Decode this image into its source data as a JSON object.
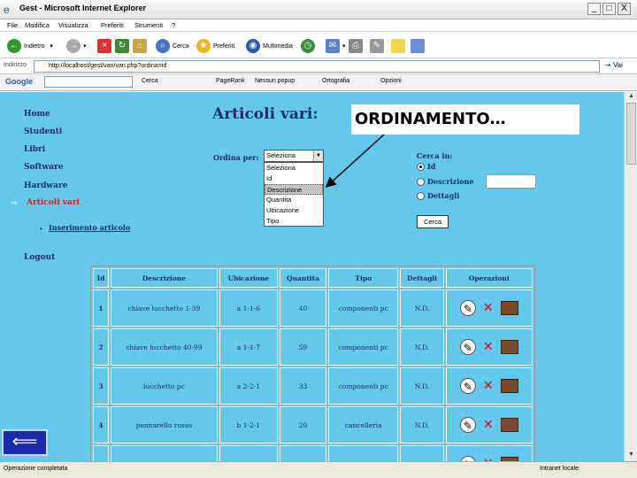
{
  "window": {
    "title": "Gest - Microsoft Internet Explorer",
    "minimize": "_",
    "maximize": "□",
    "close": "X"
  },
  "menubar": [
    "File",
    "Modifica",
    "Visualizza",
    "Preferiti",
    "Strumenti",
    "?"
  ],
  "toolbar": {
    "back": "Indietro",
    "search": "Cerca",
    "favorites": "Preferiti",
    "multimedia": "Multimedia"
  },
  "address": {
    "label": "Indirizzo",
    "url": "http://localhost/gest/vari/vari.php?ordina=id",
    "go": "Vai"
  },
  "googlebar": {
    "brand": "Google",
    "search": "Cerca",
    "pagerank": "PageRank",
    "popup": "Nessun popup",
    "spell": "Ortografia",
    "options": "Opzioni"
  },
  "nav": {
    "items": [
      "Home",
      "Studenti",
      "Libri",
      "Software",
      "Hardware",
      "Articoli vari"
    ],
    "sub_item": "Inserimento articolo",
    "logout": "Logout"
  },
  "heading": "Articoli vari:",
  "callout": "ORDINAMENTO…",
  "sort": {
    "label": "Ordina per:",
    "selected": "Seleziona",
    "options": [
      "Seleziona",
      "Id",
      "Descrizione",
      "Quantita",
      "Ubicazione",
      "Tipo"
    ],
    "highlighted_index": 2
  },
  "search": {
    "label": "Cerca in:",
    "options": [
      "Id",
      "Descrizione",
      "Dettagli"
    ],
    "checked_index": 0,
    "button": "Cerca"
  },
  "table": {
    "headers": [
      "Id",
      "Descrizione",
      "Ubicazione",
      "Quantita",
      "Tipo",
      "Dettagli",
      "Operazioni"
    ],
    "rows": [
      [
        "1",
        "chiave lucchetto 1-39",
        "a 1-1-6",
        "40",
        "componenti pc",
        "N.D."
      ],
      [
        "2",
        "chiave lucchetto 40-99",
        "a 1-1-7",
        "59",
        "componenti pc",
        "N.D."
      ],
      [
        "3",
        "lucchetto pc",
        "a 2-2-1",
        "33",
        "componenti pc",
        "N.D."
      ],
      [
        "4",
        "pennarello rosso",
        "b 1-2-1",
        "20",
        "cancelleria",
        "N.D."
      ]
    ]
  },
  "back_button": "⟸",
  "status": {
    "text": "Operazione completata",
    "zone": "Intranet locale"
  }
}
